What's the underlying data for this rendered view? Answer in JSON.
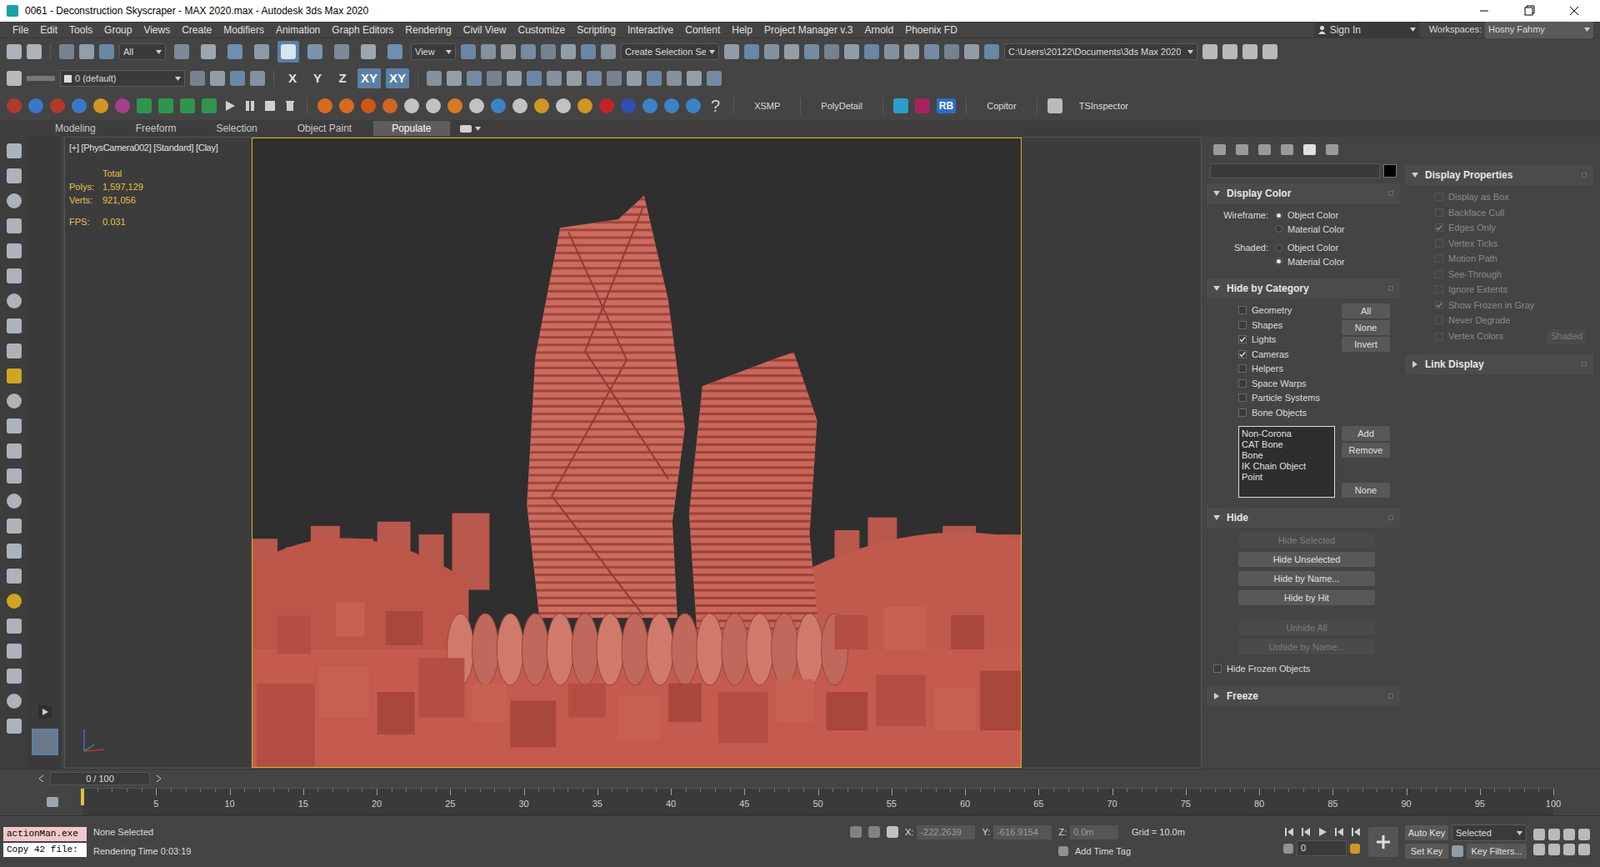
{
  "window": {
    "title": "0061 - Deconstruction Skyscraper - MAX 2020.max - Autodesk 3ds Max 2020"
  },
  "menu": [
    "File",
    "Edit",
    "Tools",
    "Group",
    "Views",
    "Create",
    "Modifiers",
    "Animation",
    "Graph Editors",
    "Rendering",
    "Civil View",
    "Customize",
    "Scripting",
    "Interactive",
    "Content",
    "Help",
    "Project Manager v.3",
    "Arnold",
    "Phoenix FD"
  ],
  "account": {
    "sign_in": "Sign In",
    "workspaces_label": "Workspaces:",
    "workspace": "Hosny Fahmy"
  },
  "main_toolbar": {
    "selection_filter": "All",
    "reference_coord": "View",
    "named_selection": "Create Selection Se",
    "project_path": "C:\\Users\\20122\\Documents\\3ds Max 2020",
    "transform_tools": [
      {
        "selected": false
      },
      {
        "selected": false
      },
      {
        "selected": false
      },
      {
        "selected": false
      },
      {
        "selected": true
      },
      {
        "selected": false
      },
      {
        "selected": false
      },
      {
        "selected": false
      },
      {
        "selected": false
      }
    ]
  },
  "layer_toolbar": {
    "layer": "0 (default)",
    "axis_constraints": [
      {
        "label": "X",
        "selected": false
      },
      {
        "label": "Y",
        "selected": false
      },
      {
        "label": "Z",
        "selected": false
      },
      {
        "label": "XY",
        "selected": true
      },
      {
        "label": "XY",
        "selected": true
      }
    ]
  },
  "plugin_toolbar": {
    "help": "?",
    "items": [
      {
        "label": "XSMP",
        "kind": "text"
      },
      {
        "label": "PolyDetail",
        "kind": "text"
      },
      {
        "label": "RB",
        "kind": "badge"
      },
      {
        "label": "Copitor",
        "kind": "text"
      },
      {
        "label": "TSInspector",
        "kind": "text"
      }
    ]
  },
  "ribbon_tabs": [
    {
      "label": "Modeling",
      "selected": false
    },
    {
      "label": "Freeform",
      "selected": false
    },
    {
      "label": "Selection",
      "selected": false
    },
    {
      "label": "Object Paint",
      "selected": false
    },
    {
      "label": "Populate",
      "selected": true
    }
  ],
  "viewport": {
    "label": "[+] [PhysCamera002] [Standard] [Clay]",
    "stats_header": "Total",
    "stats": [
      {
        "label": "Polys:",
        "value": "1,597,129"
      },
      {
        "label": "Verts:",
        "value": "921,056"
      }
    ],
    "fps": {
      "label": "FPS:",
      "value": "0.031"
    }
  },
  "command_panel": {
    "display_color": {
      "title": "Display Color",
      "expanded": true,
      "groups": [
        {
          "label": "Wireframe:",
          "options": [
            {
              "label": "Object Color",
              "selected": true
            },
            {
              "label": "Material Color",
              "selected": false
            }
          ]
        },
        {
          "label": "Shaded:",
          "options": [
            {
              "label": "Object Color",
              "selected": false
            },
            {
              "label": "Material Color",
              "selected": true
            }
          ]
        }
      ]
    },
    "hide_by_category": {
      "title": "Hide by Category",
      "expanded": true,
      "categories": [
        {
          "label": "Geometry",
          "checked": false
        },
        {
          "label": "Shapes",
          "checked": false
        },
        {
          "label": "Lights",
          "checked": true
        },
        {
          "label": "Cameras",
          "checked": true
        },
        {
          "label": "Helpers",
          "checked": false
        },
        {
          "label": "Space Warps",
          "checked": false
        },
        {
          "label": "Particle Systems",
          "checked": false
        },
        {
          "label": "Bone Objects",
          "checked": false
        }
      ],
      "category_buttons": [
        "All",
        "None",
        "Invert"
      ],
      "list": [
        "Non-Corona",
        "CAT Bone",
        "Bone",
        "IK Chain Object",
        "Point"
      ],
      "list_buttons": [
        "Add",
        "Remove"
      ],
      "list_none": "None"
    },
    "hide": {
      "title": "Hide",
      "expanded": true,
      "buttons": [
        {
          "label": "Hide Selected",
          "disabled": true
        },
        {
          "label": "Hide Unselected",
          "disabled": false
        },
        {
          "label": "Hide by Name...",
          "disabled": false
        },
        {
          "label": "Hide by Hit",
          "disabled": false
        }
      ],
      "unhide_buttons": [
        {
          "label": "Unhide All",
          "disabled": true
        },
        {
          "label": "Unhide by Name...",
          "disabled": true
        }
      ],
      "hide_frozen": {
        "label": "Hide Frozen Objects",
        "checked": false
      }
    },
    "freeze": {
      "title": "Freeze",
      "expanded": false
    }
  },
  "display_properties": {
    "title": "Display Properties",
    "expanded": true,
    "options": [
      {
        "label": "Display as Box",
        "checked": false
      },
      {
        "label": "Backface Cull",
        "checked": false
      },
      {
        "label": "Edges Only",
        "checked": true
      },
      {
        "label": "Vertex Ticks",
        "checked": false
      },
      {
        "label": "Motion Path",
        "checked": false
      },
      {
        "label": "See-Through",
        "checked": false
      },
      {
        "label": "Ignore Extents",
        "checked": false
      },
      {
        "label": "Show Frozen in Gray",
        "checked": true
      },
      {
        "label": "Never Degrade",
        "checked": false
      },
      {
        "label": "Vertex Colors",
        "checked": false
      }
    ],
    "shaded_button": "Shaded",
    "link_display": {
      "title": "Link Display",
      "expanded": false
    }
  },
  "timeline": {
    "slider": "0 / 100",
    "level": 0,
    "ticks": [
      "5",
      "10",
      "15",
      "20",
      "25",
      "30",
      "35",
      "40",
      "45",
      "50",
      "55",
      "60",
      "65",
      "70",
      "75",
      "80",
      "85",
      "90",
      "95",
      "100"
    ]
  },
  "status_bar": {
    "listener": [
      "actionMan.exe",
      "Copy 42 file:"
    ],
    "selection": "None Selected",
    "render_time": "Rendering Time 0:03:19",
    "coords": [
      {
        "label": "X:",
        "value": "-222.2639"
      },
      {
        "label": "Y:",
        "value": "-616.9154"
      },
      {
        "label": "Z:",
        "value": "0.0m"
      }
    ],
    "grid": "Grid = 10.0m",
    "time_tag": "Add Time Tag",
    "auto_key": "Auto Key",
    "key_mode": "Selected",
    "set_key": "Set Key",
    "key_filters": "Key Filters...",
    "frame": "0"
  }
}
